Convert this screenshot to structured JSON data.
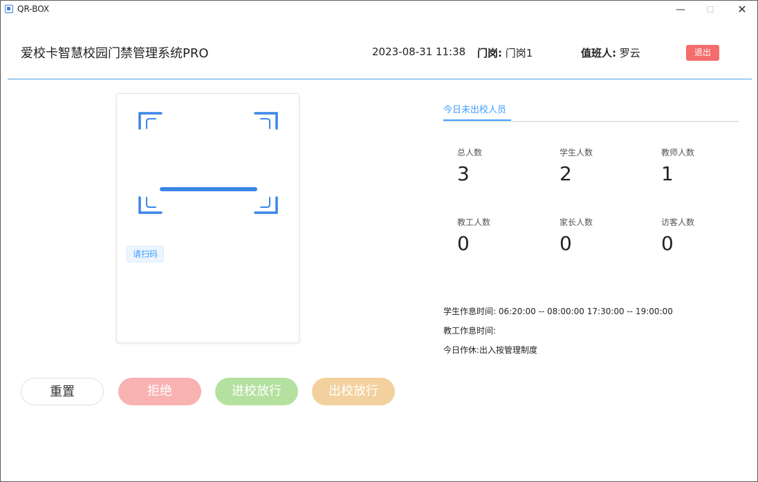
{
  "window": {
    "title": "QR-BOX",
    "minimize": "—",
    "maximize": "☐",
    "close": "✕"
  },
  "header": {
    "system_title": "爱校卡智慧校园门禁管理系统PRO",
    "datetime": "2023-08-31 11:38",
    "gate_label": "门岗:",
    "gate_value": "门岗1",
    "duty_label": "值班人:",
    "duty_value": "罗云",
    "logout": "退出"
  },
  "scan": {
    "tip": "请扫码",
    "icon": "qr-scan-frame-icon",
    "accent": "#3b86e6"
  },
  "buttons": {
    "reset": "重置",
    "reject": "拒绝",
    "enter": "进校放行",
    "exit": "出校放行"
  },
  "panel": {
    "tab": "今日未出校人员",
    "stats": [
      {
        "label": "总人数",
        "value": "3"
      },
      {
        "label": "学生人数",
        "value": "2"
      },
      {
        "label": "教师人数",
        "value": "1"
      },
      {
        "label": "教工人数",
        "value": "0"
      },
      {
        "label": "家长人数",
        "value": "0"
      },
      {
        "label": "访客人数",
        "value": "0"
      }
    ],
    "info": {
      "student_schedule": "学生作息时间: 06:20:00 -- 08:00:00   17:30:00 -- 19:00:00",
      "staff_schedule": "教工作息时间:",
      "today_rest": "今日作休:出入按管理制度"
    }
  },
  "colors": {
    "primary": "#409eff",
    "danger": "#f56c6c",
    "divider": "#4aa0e0"
  }
}
